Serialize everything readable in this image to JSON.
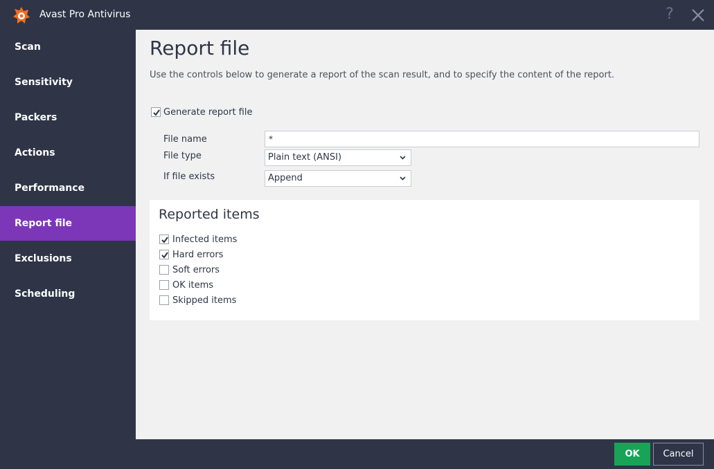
{
  "window": {
    "title": "Avast Pro Antivirus",
    "help_glyph": "?"
  },
  "colors": {
    "brand_orange": "#f26e21",
    "accent_purple": "#7b37b8",
    "ok_green": "#19a357",
    "dark_bg": "#2f3547"
  },
  "sidebar": {
    "items": [
      {
        "label": "Scan"
      },
      {
        "label": "Sensitivity"
      },
      {
        "label": "Packers"
      },
      {
        "label": "Actions"
      },
      {
        "label": "Performance"
      },
      {
        "label": "Report file",
        "active": true
      },
      {
        "label": "Exclusions"
      },
      {
        "label": "Scheduling"
      }
    ]
  },
  "main": {
    "title": "Report file",
    "description": "Use the controls below to generate a report of the scan result, and to specify the content of the report.",
    "generate": {
      "label": "Generate report file",
      "checked": true
    },
    "file_name": {
      "label": "File name",
      "value": "*"
    },
    "file_type": {
      "label": "File type",
      "value": "Plain text (ANSI)"
    },
    "if_exists": {
      "label": "If file exists",
      "value": "Append"
    },
    "reported": {
      "title": "Reported items",
      "items": [
        {
          "label": "Infected items",
          "checked": true
        },
        {
          "label": "Hard errors",
          "checked": true
        },
        {
          "label": "Soft errors",
          "checked": false
        },
        {
          "label": "OK items",
          "checked": false
        },
        {
          "label": "Skipped items",
          "checked": false
        }
      ]
    }
  },
  "footer": {
    "ok_label": "OK",
    "cancel_label": "Cancel"
  }
}
